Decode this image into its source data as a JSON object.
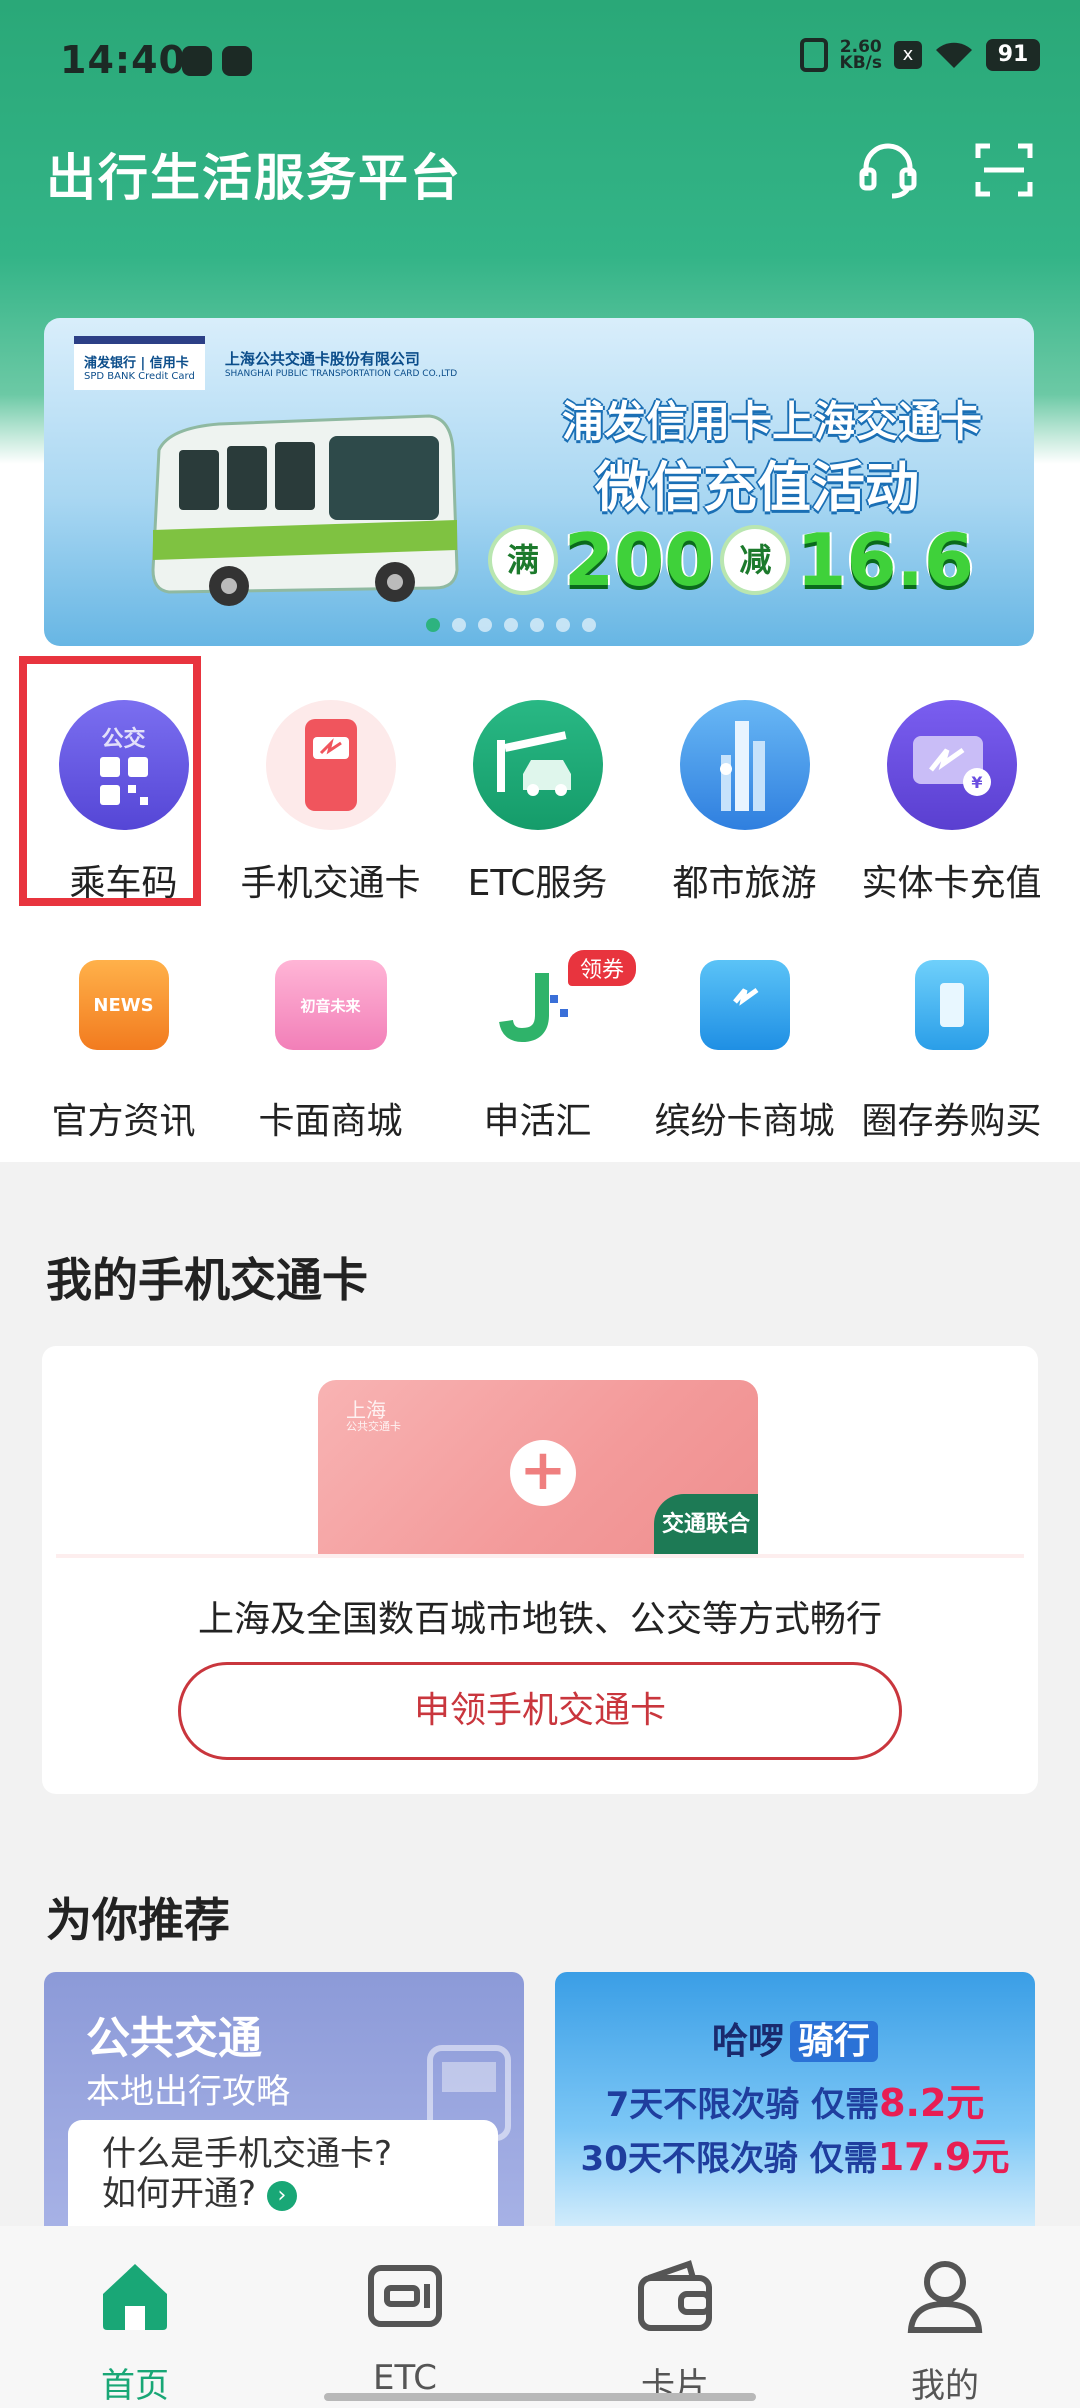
{
  "status": {
    "time": "14:40",
    "speed_value": "2.60",
    "speed_unit": "KB/s",
    "battery": "91",
    "x_badge": "x"
  },
  "header": {
    "title": "出行生活服务平台",
    "support_icon": "headset-icon",
    "scan_icon": "scan-icon"
  },
  "banner": {
    "bank_logo": "浦发银行 | 信用卡",
    "bank_logo_en": "SPD BANK  Credit Card",
    "company_logo": "上海公共交通卡股份有限公司",
    "company_logo_en": "SHANGHAI PUBLIC TRANSPORTATION CARD CO.,LTD",
    "line1": "浦发信用卡上海交通卡",
    "line2": "微信充值活动",
    "promo_full": "满",
    "promo_full_value": "200",
    "promo_off": "减",
    "promo_off_value": "16.6",
    "active_dot": 0
  },
  "grid": {
    "row1": [
      {
        "label": "乘车码",
        "icon": "ride-code-icon",
        "badge": "公交",
        "color": "#6a5fe0"
      },
      {
        "label": "手机交通卡",
        "icon": "mobile-transit-card-icon",
        "color": "#ef4a52"
      },
      {
        "label": "ETC服务",
        "icon": "etc-car-icon",
        "color": "#1fae7a"
      },
      {
        "label": "都市旅游",
        "icon": "city-tour-icon",
        "color": "#2f8fe6"
      },
      {
        "label": "实体卡充值",
        "icon": "card-recharge-icon",
        "color": "#6a4ee0"
      }
    ],
    "row2": [
      {
        "label": "官方资讯",
        "icon": "news-icon",
        "text": "NEWS",
        "color": "#f5842a"
      },
      {
        "label": "卡面商城",
        "icon": "card-face-shop-icon",
        "text": "初音未来",
        "color": "#f27fb8"
      },
      {
        "label": "申活汇",
        "icon": "shenhuohui-icon",
        "badge": "领券",
        "color": "#2fb36a"
      },
      {
        "label": "缤纷卡商城",
        "icon": "shopping-bag-icon",
        "color": "#2aa3ef"
      },
      {
        "label": "圈存券购买",
        "icon": "voucher-icon",
        "color": "#3ab2ef"
      }
    ]
  },
  "my_card": {
    "section_title": "我的手机交通卡",
    "card_brand": "上海",
    "card_brand_sub": "公共交通卡",
    "union_badge": "交通联合",
    "description": "上海及全国数百城市地铁、公交等方式畅行",
    "apply_button": "申领手机交通卡"
  },
  "recommend": {
    "section_title": "为你推荐",
    "left": {
      "title": "公共交通",
      "subtitle": "本地出行攻略",
      "question_line1": "什么是手机交通卡?",
      "question_line2": "如何开通?"
    },
    "right": {
      "brand": "哈啰",
      "brand_tag": "骑行",
      "deal1_prefix": "7天不限次骑 仅需",
      "deal1_price": "8.2元",
      "deal2_prefix": "30天不限次骑 仅需",
      "deal2_price": "17.9元"
    }
  },
  "tabs": [
    {
      "label": "首页",
      "icon": "home-icon",
      "active": true
    },
    {
      "label": "ETC",
      "icon": "etc-card-icon",
      "active": false
    },
    {
      "label": "卡片",
      "icon": "wallet-icon",
      "active": false
    },
    {
      "label": "我的",
      "icon": "user-icon",
      "active": false
    }
  ]
}
